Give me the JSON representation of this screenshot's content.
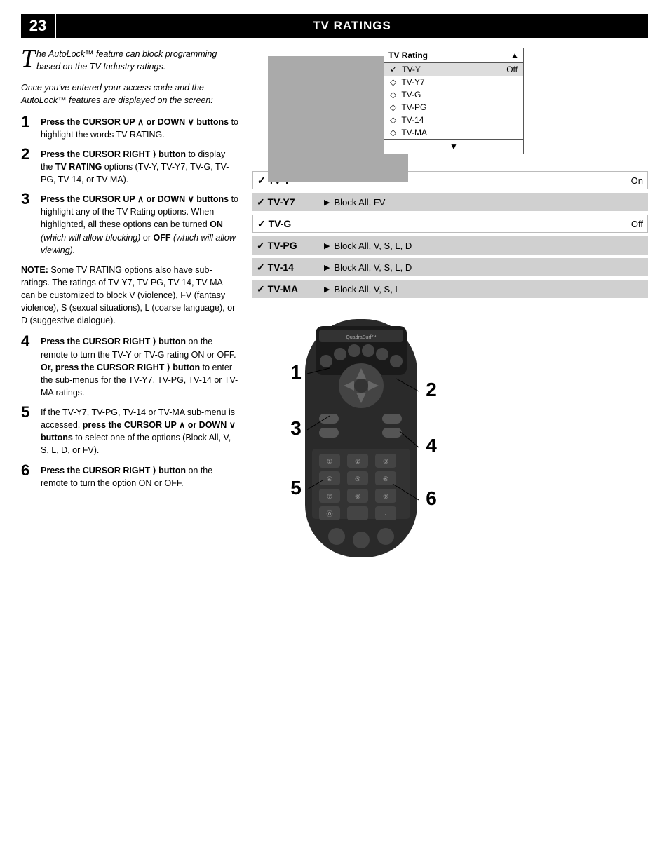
{
  "header": {
    "page_number": "23",
    "title": "TV R",
    "title_suffix": "ATINGS"
  },
  "intro": {
    "drop_cap": "T",
    "text": "he AutoLock™ feature can block programming based on the TV Industry ratings.",
    "once_text": "Once you've entered your access code and the AutoLock™ features are displayed on the screen:"
  },
  "steps": [
    {
      "num": "1",
      "text": "Press the CURSOR UP ∧ or DOWN ∨ buttons to highlight the words TV RATING."
    },
    {
      "num": "2",
      "text": "Press the CURSOR RIGHT ⟩ button to display the TV RATING options (TV-Y, TV-Y7, TV-G, TV-PG, TV-14, or TV-MA)."
    },
    {
      "num": "3",
      "text": "Press the CURSOR UP ∧ or DOWN ∨ buttons to highlight any of the TV Rating options. When highlighted, all these options can be turned ON (which will allow blocking) or OFF (which will allow viewing)."
    },
    {
      "num": "4",
      "text": "Press the CURSOR RIGHT ⟩ button on the remote to turn the TV-Y or TV-G rating ON or OFF. Or, press the CURSOR RIGHT ⟩ button to enter the sub-menus for the TV-Y7, TV-PG, TV-14 or TV-MA ratings."
    },
    {
      "num": "5",
      "text": "If the TV-Y7, TV-PG, TV-14 or TV-MA sub-menu is accessed, press the CURSOR UP ∧ or DOWN ∨ buttons to select one of the options (Block All, V, S, L, D, or FV)."
    },
    {
      "num": "6",
      "text": "Press the CURSOR RIGHT ⟩ button on the remote to turn the option ON or OFF."
    }
  ],
  "note": {
    "label": "NOTE:",
    "text": "Some TV RATING options also have sub-ratings. The ratings of TV-Y7, TV-PG, TV-14, TV-MA can be customized to block V (violence), FV (fantasy violence), S (sexual situations), L (coarse language), or D (suggestive dialogue)."
  },
  "tv_menu": {
    "header_label": "TV Rating",
    "header_arrow": "▲",
    "rows": [
      {
        "check": "✓",
        "label": "TV-Y",
        "value": "Off",
        "selected": true
      },
      {
        "dot": "◇",
        "label": "TV-Y7",
        "value": ""
      },
      {
        "dot": "◇",
        "label": "TV-G",
        "value": ""
      },
      {
        "dot": "◇",
        "label": "TV-PG",
        "value": ""
      },
      {
        "dot": "◇",
        "label": "TV-14",
        "value": ""
      },
      {
        "dot": "◇",
        "label": "TV-MA",
        "value": ""
      }
    ],
    "footer_arrow": "▼"
  },
  "rating_display": [
    {
      "check": "✓",
      "label": "TV-Y",
      "arrow": "",
      "value": "On",
      "gray": false
    },
    {
      "check": "✓",
      "label": "TV-Y7",
      "arrow": "▶",
      "value": "Block All, FV",
      "gray": true
    },
    {
      "check": "✓",
      "label": "TV-G",
      "arrow": "",
      "value": "Off",
      "gray": false
    },
    {
      "check": "✓",
      "label": "TV-PG",
      "arrow": "▶",
      "value": "Block All, V, S, L, D",
      "gray": true
    },
    {
      "check": "✓",
      "label": "TV-14",
      "arrow": "▶",
      "value": "Block All, V, S, L, D",
      "gray": true
    },
    {
      "check": "✓",
      "label": "TV-MA",
      "arrow": "▶",
      "value": "Block All, V, S, L",
      "gray": true
    }
  ],
  "callouts": [
    "1",
    "3",
    "5",
    "2",
    "4",
    "6"
  ]
}
